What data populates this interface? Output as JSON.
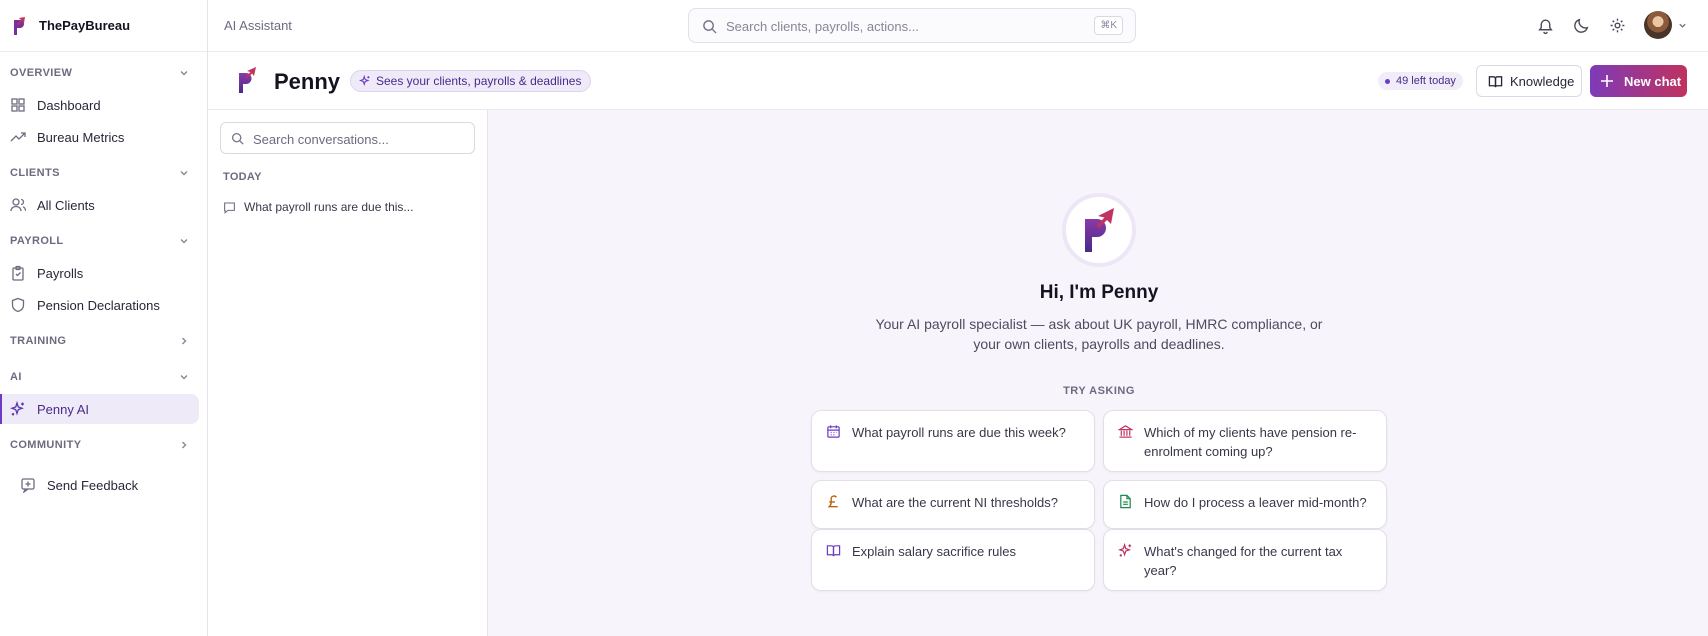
{
  "brand": {
    "name": "ThePayBureau"
  },
  "sidebar": {
    "sections": [
      {
        "label": "OVERVIEW",
        "items": [
          {
            "label": "Dashboard",
            "icon": "grid-icon"
          },
          {
            "label": "Bureau Metrics",
            "icon": "trend-icon"
          }
        ]
      },
      {
        "label": "CLIENTS",
        "items": [
          {
            "label": "All Clients",
            "icon": "users-icon"
          }
        ]
      },
      {
        "label": "PAYROLL",
        "items": [
          {
            "label": "Payrolls",
            "icon": "clipboard-icon"
          },
          {
            "label": "Pension Declarations",
            "icon": "shield-icon"
          }
        ]
      },
      {
        "label": "TRAINING",
        "items": []
      },
      {
        "label": "AI",
        "items": [
          {
            "label": "Penny AI",
            "icon": "sparkle-icon",
            "active": true
          }
        ]
      },
      {
        "label": "COMMUNITY",
        "items": []
      }
    ],
    "feedback": "Send Feedback"
  },
  "topbar": {
    "crumb": "AI Assistant",
    "search_placeholder": "Search clients, payrolls, actions...",
    "shortcut": "⌘K"
  },
  "penny": {
    "title": "Penny",
    "pill": "Sees your clients, payrolls & deadlines",
    "left_today": "49 left today",
    "knowledge": "Knowledge",
    "new_chat": "New chat"
  },
  "conversations": {
    "search_placeholder": "Search conversations...",
    "group": "TODAY",
    "items": [
      "What payroll runs are due this..."
    ]
  },
  "hero": {
    "title": "Hi, I'm Penny",
    "subtitle": "Your AI payroll specialist — ask about UK payroll, HMRC compliance, or your own clients, payrolls and deadlines.",
    "try_label": "TRY ASKING",
    "suggestions": [
      {
        "text": "What payroll runs are due this week?",
        "icon": "calendar-icon",
        "color": "#6b3bc6"
      },
      {
        "text": "Which of my clients have pension re-enrolment coming up?",
        "icon": "bank-icon",
        "color": "#c0325f"
      },
      {
        "text": "What are the current NI thresholds?",
        "icon": "pound-icon",
        "color": "#b8650f"
      },
      {
        "text": "How do I process a leaver mid-month?",
        "icon": "document-icon",
        "color": "#1f8a4c"
      },
      {
        "text": "Explain salary sacrifice rules",
        "icon": "book-icon",
        "color": "#6b3bc6"
      },
      {
        "text": "What's changed for the current tax year?",
        "icon": "sparkle-icon",
        "color": "#c0325f"
      }
    ]
  },
  "colors": {
    "accent": "#6b3bc6",
    "brand_gradient_start": "#7e3bb8",
    "brand_gradient_end": "#c0325f"
  }
}
